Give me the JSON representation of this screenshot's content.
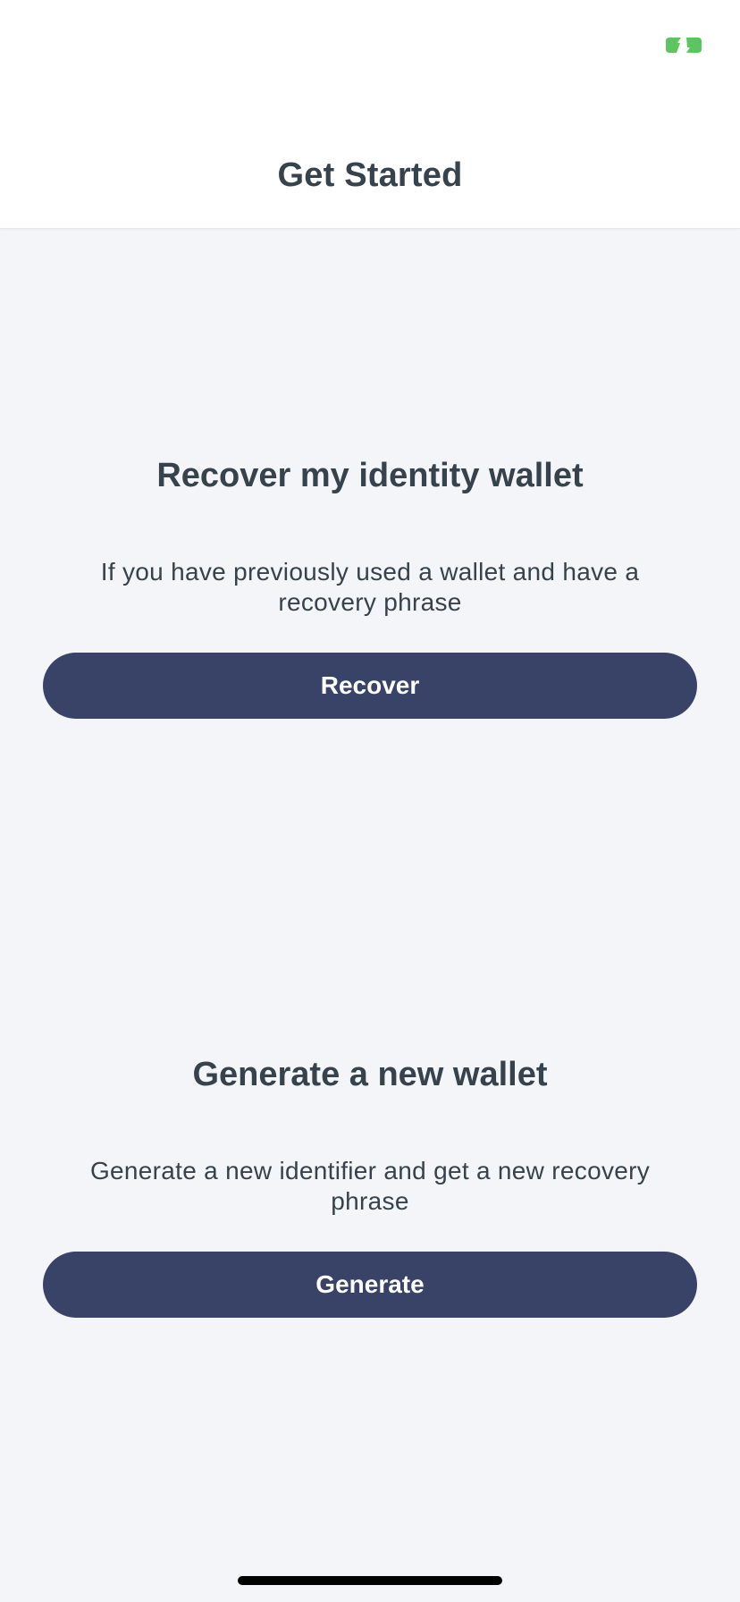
{
  "header": {
    "title": "Get Started",
    "status_icon": "battery-charging-icon",
    "status_color": "#5cc55f"
  },
  "recover": {
    "heading": "Recover my identity wallet",
    "description": "If you have previously used a wallet and have a recovery phrase",
    "button_label": "Recover"
  },
  "generate": {
    "heading": "Generate a new wallet",
    "description": "Generate a new identifier and get a new recovery phrase",
    "button_label": "Generate"
  },
  "colors": {
    "background": "#f4f5f9",
    "header_background": "#ffffff",
    "text": "#36424c",
    "button": "#394267",
    "button_text": "#ffffff"
  }
}
